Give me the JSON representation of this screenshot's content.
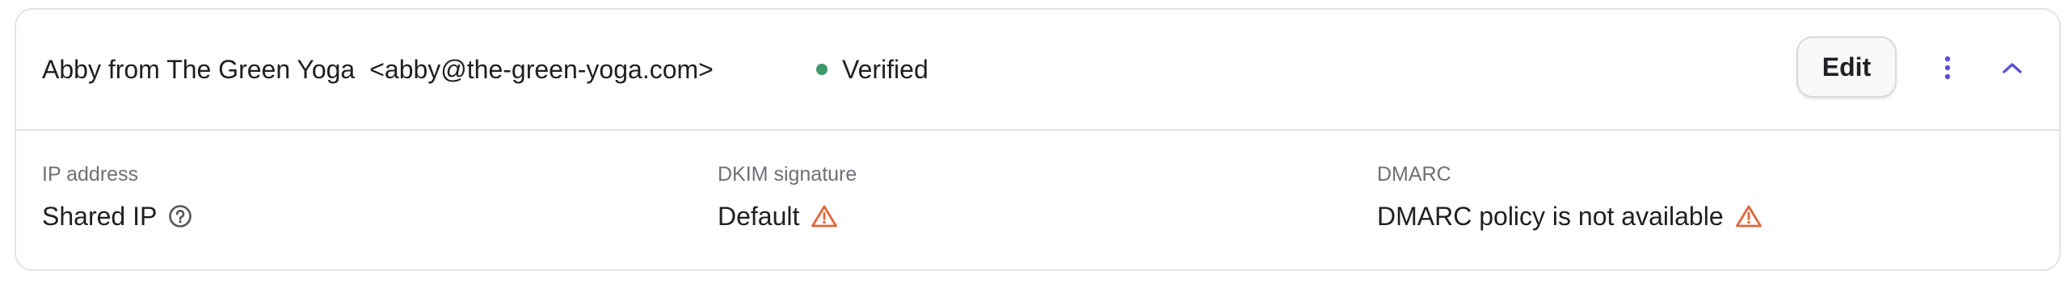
{
  "sender": {
    "name": "Abby from The Green Yoga",
    "email": "<abby@the-green-yoga.com>"
  },
  "status": {
    "label": "Verified",
    "color": "#3e9a6c"
  },
  "actions": {
    "edit_label": "Edit",
    "more_icon": "more-vertical-icon",
    "collapse_icon": "chevron-up-icon",
    "accent_color": "#5b4fd6"
  },
  "details": {
    "ip": {
      "label": "IP address",
      "value": "Shared IP",
      "icon": "help-circle-icon"
    },
    "dkim": {
      "label": "DKIM signature",
      "value": "Default",
      "icon": "warning-icon"
    },
    "dmarc": {
      "label": "DMARC",
      "value": "DMARC policy is not available",
      "icon": "warning-icon"
    }
  },
  "warning_color": "#e2663b"
}
